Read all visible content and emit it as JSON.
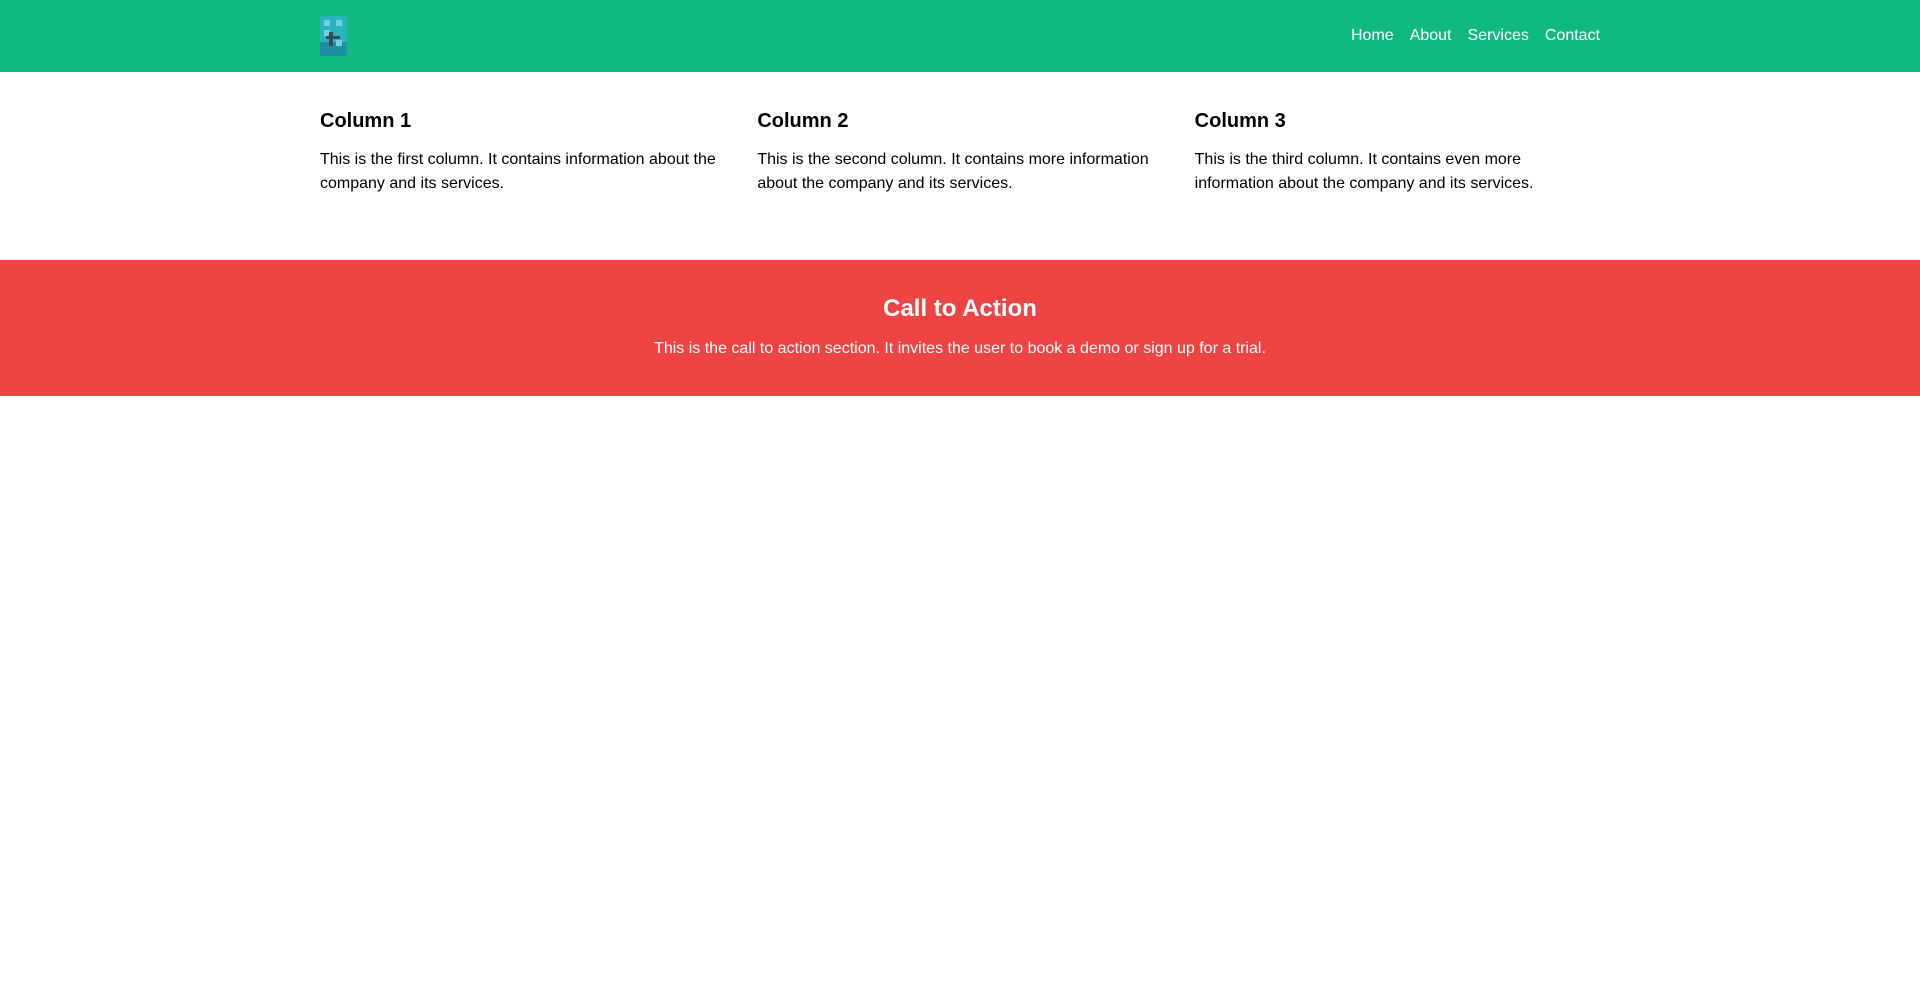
{
  "header": {
    "logo_icon": "building-logo-icon",
    "nav": [
      {
        "label": "Home"
      },
      {
        "label": "About"
      },
      {
        "label": "Services"
      },
      {
        "label": "Contact"
      }
    ]
  },
  "columns": [
    {
      "title": "Column 1",
      "text": "This is the first column. It contains information about the company and its services."
    },
    {
      "title": "Column 2",
      "text": "This is the second column. It contains more information about the company and its services."
    },
    {
      "title": "Column 3",
      "text": "This is the third column. It contains even more information about the company and its services."
    }
  ],
  "cta": {
    "title": "Call to Action",
    "text": "This is the call to action section. It invites the user to book a demo or sign up for a trial."
  },
  "colors": {
    "header_bg": "#10b981",
    "cta_bg": "#ef4444",
    "text_light": "#ffffff",
    "text_dark": "#000000"
  }
}
